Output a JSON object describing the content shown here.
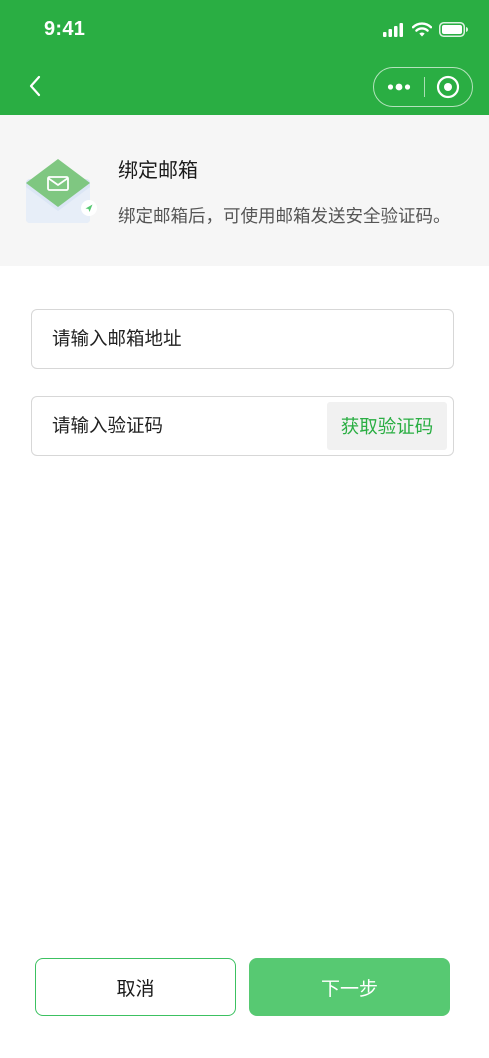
{
  "status_bar": {
    "time": "9:41",
    "icons": [
      "signal-icon",
      "wifi-icon",
      "battery-icon"
    ]
  },
  "nav": {
    "back_icon": "chevron-left-icon",
    "capsule_icons": [
      "more-dots-icon",
      "close-target-icon"
    ]
  },
  "info": {
    "title": "绑定邮箱",
    "description": "绑定邮箱后，可使用邮箱发送安全验证码。",
    "icon": "envelope-icon"
  },
  "form": {
    "email_placeholder": "请输入邮箱地址",
    "email_value": "",
    "code_placeholder": "请输入验证码",
    "code_value": "",
    "get_code_label": "获取验证码"
  },
  "actions": {
    "cancel_label": "取消",
    "next_label": "下一步"
  },
  "colors": {
    "brand_green": "#2aae43",
    "button_green": "#57c972",
    "banner_bg": "#f6f6f6"
  }
}
